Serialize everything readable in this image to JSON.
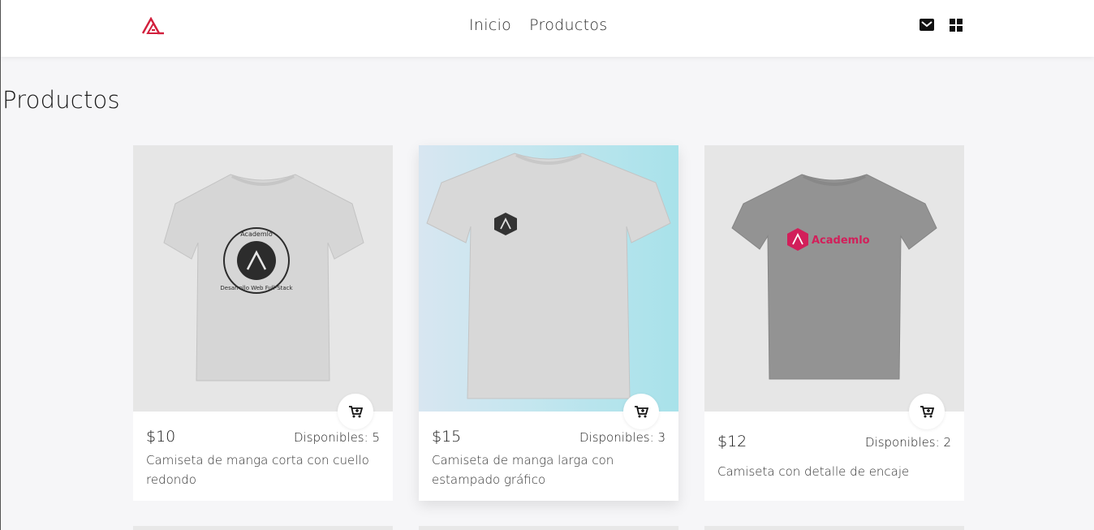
{
  "nav": {
    "links": [
      "Inicio",
      "Productos"
    ],
    "icons": [
      "cart-icon",
      "grid-icon"
    ],
    "brand_color": "#d21f3c"
  },
  "page": {
    "title": "Productos"
  },
  "products": [
    {
      "price": "$10",
      "stock": "Disponibles: 5",
      "description": "Camiseta de manga corta con cuello redondo",
      "shirt_color": "#d6d6d6",
      "print_text_1": "Academlo",
      "print_text_2": "Desarrollo Web Full-Stack"
    },
    {
      "price": "$15",
      "stock": "Disponibles: 3",
      "description": "Camiseta de manga larga con estampado gráfico",
      "shirt_color": "#d8d8d8"
    },
    {
      "price": "$12",
      "stock": "Disponibles: 2",
      "description": "Camiseta con detalle de encaje",
      "shirt_color": "#939393",
      "print_text": "Academlo"
    }
  ]
}
